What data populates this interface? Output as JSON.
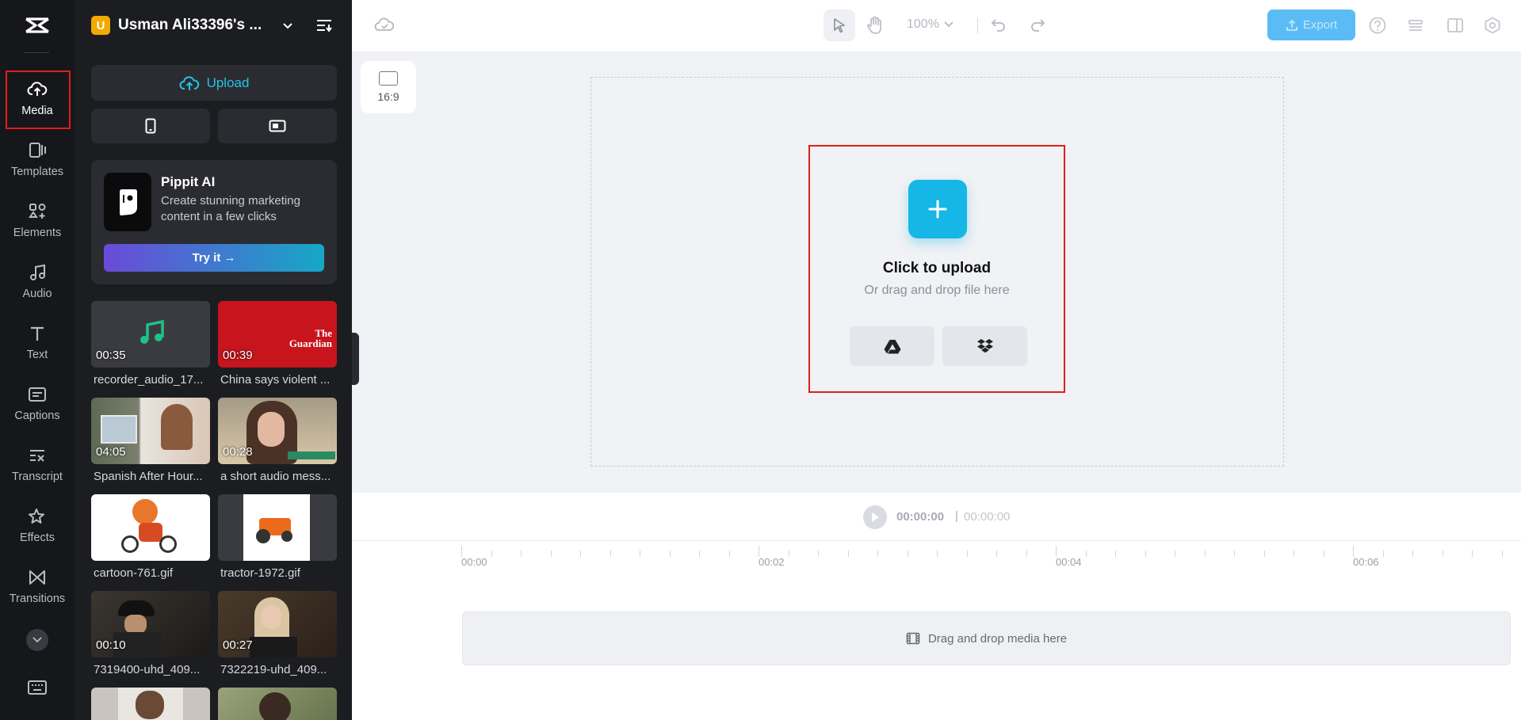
{
  "rail": {
    "items": [
      {
        "label": "Media",
        "icon": "cloud-upload-icon",
        "active": true
      },
      {
        "label": "Templates",
        "icon": "templates-icon"
      },
      {
        "label": "Elements",
        "icon": "elements-icon"
      },
      {
        "label": "Audio",
        "icon": "music-note-icon"
      },
      {
        "label": "Text",
        "icon": "text-icon"
      },
      {
        "label": "Captions",
        "icon": "captions-icon"
      },
      {
        "label": "Transcript",
        "icon": "transcript-icon"
      },
      {
        "label": "Effects",
        "icon": "effects-icon"
      },
      {
        "label": "Transitions",
        "icon": "transitions-icon"
      }
    ]
  },
  "panel": {
    "workspace_initial": "U",
    "workspace_name": "Usman Ali33396's ...",
    "upload_label": "Upload",
    "promo": {
      "title": "Pippit AI",
      "description": "Create stunning marketing content in a few clicks",
      "button": "Try it →"
    },
    "media": [
      {
        "name": "recorder_audio_17...",
        "duration": "00:35"
      },
      {
        "name": "China says violent ...",
        "duration": "00:39",
        "thumb_text": "The Guardian"
      },
      {
        "name": "Spanish After Hour...",
        "duration": "04:05"
      },
      {
        "name": "a short audio mess...",
        "duration": "00:28"
      },
      {
        "name": "cartoon-761.gif",
        "duration": ""
      },
      {
        "name": "tractor-1972.gif",
        "duration": ""
      },
      {
        "name": "7319400-uhd_409...",
        "duration": "00:10"
      },
      {
        "name": "7322219-uhd_409...",
        "duration": "00:27"
      }
    ]
  },
  "toolbar": {
    "zoom": "100%",
    "export_label": "Export"
  },
  "canvas": {
    "aspect_ratio": "16:9",
    "upload_title": "Click to upload",
    "upload_subtitle": "Or drag and drop file here"
  },
  "player": {
    "current_time": "00:00:00",
    "separator": "|",
    "total_time": "00:00:00"
  },
  "timeline": {
    "ticks": [
      "00:00",
      "00:02",
      "00:04",
      "00:06"
    ],
    "drop_label": "Drag and drop media here"
  },
  "colors": {
    "accent": "#16b7e6",
    "highlight_border": "#e01e1e",
    "rail_bg": "#16171a",
    "panel_bg": "#1c1d21"
  }
}
